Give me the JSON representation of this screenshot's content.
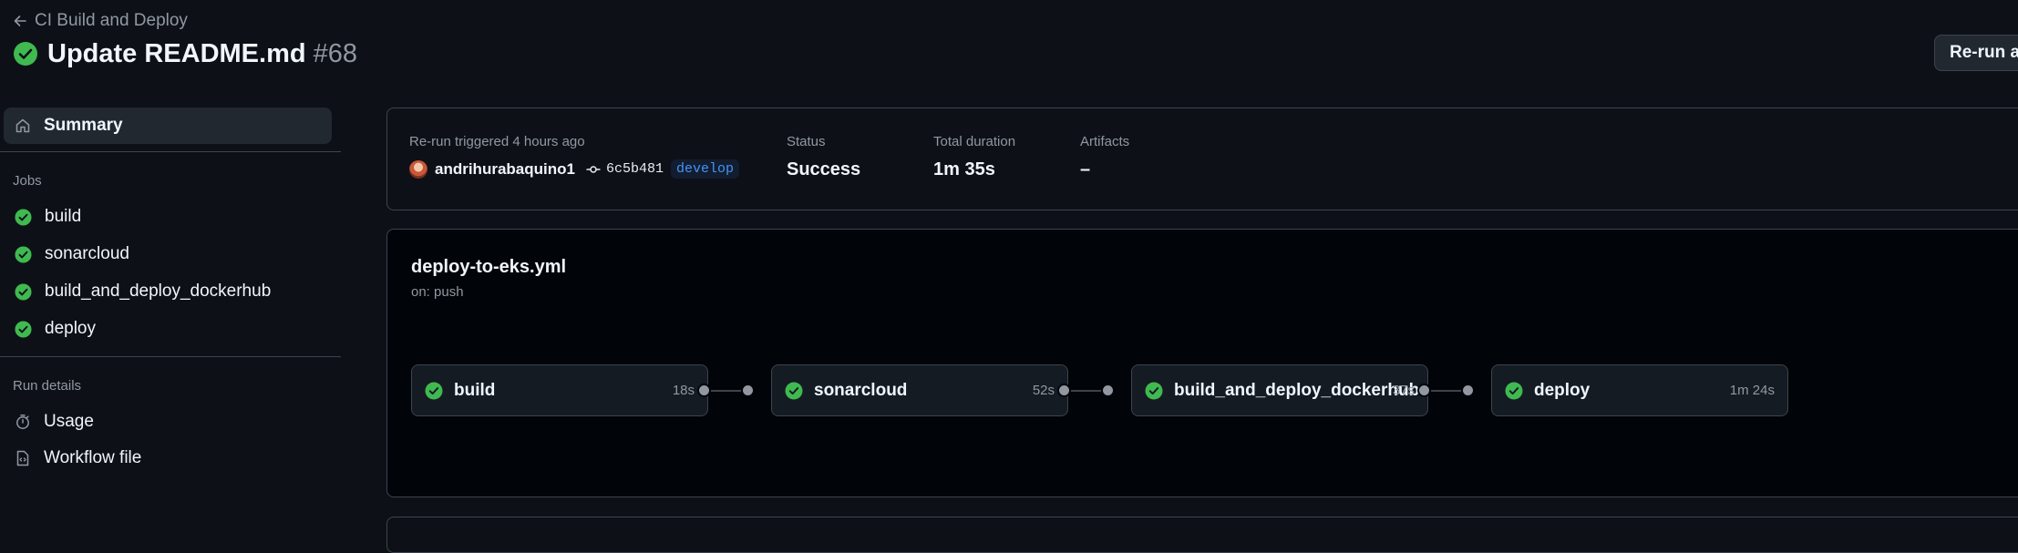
{
  "header": {
    "back_label": "CI Build and Deploy",
    "title": "Update README.md",
    "run_number": "#68",
    "rerun_label": "Re-run all jobs"
  },
  "sidebar": {
    "summary_label": "Summary",
    "jobs_heading": "Jobs",
    "jobs": [
      {
        "label": "build",
        "status": "success"
      },
      {
        "label": "sonarcloud",
        "status": "success"
      },
      {
        "label": "build_and_deploy_dockerhub",
        "status": "success"
      },
      {
        "label": "deploy",
        "status": "success"
      }
    ],
    "run_details_heading": "Run details",
    "usage_label": "Usage",
    "workflow_file_label": "Workflow file"
  },
  "summary": {
    "trigger_label": "Re-run triggered 4 hours ago",
    "author": "andrihurabaquino1",
    "commit": "6c5b481",
    "branch": "develop",
    "status_label": "Status",
    "status_value": "Success",
    "duration_label": "Total duration",
    "duration_value": "1m 35s",
    "artifacts_label": "Artifacts",
    "artifacts_value": "–"
  },
  "workflow": {
    "file": "deploy-to-eks.yml",
    "trigger": "on: push",
    "jobs": [
      {
        "name": "build",
        "duration": "18s"
      },
      {
        "name": "sonarcloud",
        "duration": "52s"
      },
      {
        "name": "build_and_deploy_dockerhub",
        "duration": "37s"
      },
      {
        "name": "deploy",
        "duration": "1m 24s"
      }
    ]
  },
  "colors": {
    "success": "#3fb950",
    "background": "#0d1117",
    "graph_background": "#010409",
    "border": "#3d444d",
    "muted_text": "#9198a1",
    "branch_text": "#4493f8"
  }
}
